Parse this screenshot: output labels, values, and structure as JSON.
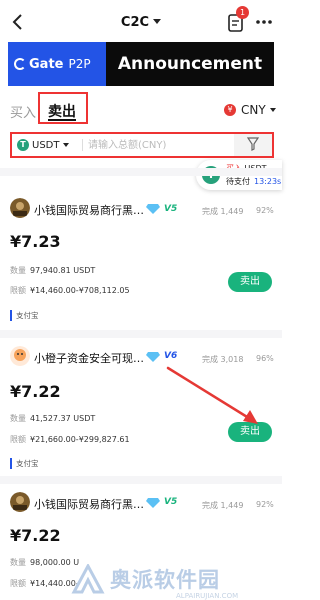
{
  "nav": {
    "title": "C2C",
    "order_badge": "1"
  },
  "banner": {
    "brand": "Gate",
    "brand_suffix": "P2P",
    "headline": "Announcement"
  },
  "tabs": {
    "buy": "买入",
    "sell": "卖出"
  },
  "currency": {
    "symbol": "¥",
    "code": "CNY"
  },
  "filter": {
    "token": "USDT",
    "token_icon": "T",
    "amount_placeholder": "请输入总额(CNY)",
    "filter_hint": "筛选条件"
  },
  "floating_order": {
    "action": "买入",
    "token": "USDT",
    "status": "待支付",
    "timer": "13:23s"
  },
  "listings": [
    {
      "name": "小钱国际贸易商行黑…",
      "level": "V5",
      "completed_label": "完成",
      "completed": "1,449",
      "rate": "92%",
      "price": "¥7.23",
      "qty_label": "数量",
      "qty": "97,940.81 USDT",
      "limit_label": "限额",
      "limit": "¥14,460.00-¥708,112.05",
      "payment": "支付宝",
      "action": "卖出"
    },
    {
      "name": "小橙子资金安全可现…",
      "level": "V6",
      "completed_label": "完成",
      "completed": "3,018",
      "rate": "96%",
      "price": "¥7.22",
      "qty_label": "数量",
      "qty": "41,527.37 USDT",
      "limit_label": "限额",
      "limit": "¥21,660.00-¥299,827.61",
      "payment": "支付宝",
      "action": "卖出"
    },
    {
      "name": "小钱国际贸易商行黑…",
      "level": "V5",
      "completed_label": "完成",
      "completed": "1,449",
      "rate": "92%",
      "price": "¥7.22",
      "qty_label": "数量",
      "qty": "98,000.00 U",
      "limit_label": "限额",
      "limit": "¥14,440.00-"
    }
  ],
  "watermark": {
    "text": "奥派软件园",
    "sub": "ALPAIRUJIAN.COM"
  },
  "colors": {
    "accent_green": "#19b37d",
    "highlight_red": "#e33333",
    "brand_blue": "#2354e6"
  }
}
